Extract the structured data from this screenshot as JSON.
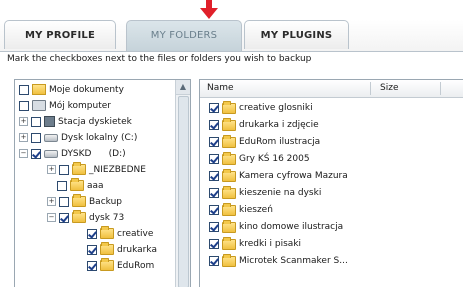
{
  "tabs": [
    {
      "label": "MY PROFILE",
      "active": false
    },
    {
      "label": "MY FOLDERS",
      "active": true
    },
    {
      "label": "MY PLUGINS",
      "active": false
    }
  ],
  "instruction": "Mark the checkboxes next to the files or folders you wish to backup",
  "tree": [
    {
      "label": "Moje dokumenty",
      "checked": false
    },
    {
      "label": "Mój komputer",
      "checked": false
    },
    {
      "label": "Stacja dyskietek",
      "checked": false
    },
    {
      "label": "Dysk lokalny (C:)",
      "checked": false
    },
    {
      "label": "DYSKD      (D:)",
      "checked": true
    },
    {
      "label": "_NIEZBEDNE",
      "checked": false
    },
    {
      "label": "aaa",
      "checked": false
    },
    {
      "label": "Backup",
      "checked": false
    },
    {
      "label": "dysk 73",
      "checked": true
    },
    {
      "label": "creative",
      "checked": true
    },
    {
      "label": "drukarka",
      "checked": true
    },
    {
      "label": "EduRom",
      "checked": true
    }
  ],
  "list_headers": {
    "name": "Name",
    "size": "Size"
  },
  "files": [
    {
      "name": "creative glosniki",
      "checked": true
    },
    {
      "name": "drukarka i zdjęcie",
      "checked": true
    },
    {
      "name": "EduRom ilustracja",
      "checked": true
    },
    {
      "name": "Gry KŚ 16 2005",
      "checked": true
    },
    {
      "name": "Kamera cyfrowa Mazura",
      "checked": true
    },
    {
      "name": "kieszenie na dyski",
      "checked": true
    },
    {
      "name": "kieszeń",
      "checked": true
    },
    {
      "name": "kino domowe ilustracja",
      "checked": true
    },
    {
      "name": "kredki i pisaki",
      "checked": true
    },
    {
      "name": "Microtek Scanmaker S...",
      "checked": true
    }
  ],
  "colors": {
    "annotation_arrow": "#e0202a",
    "accent": "#1d3f8a"
  }
}
